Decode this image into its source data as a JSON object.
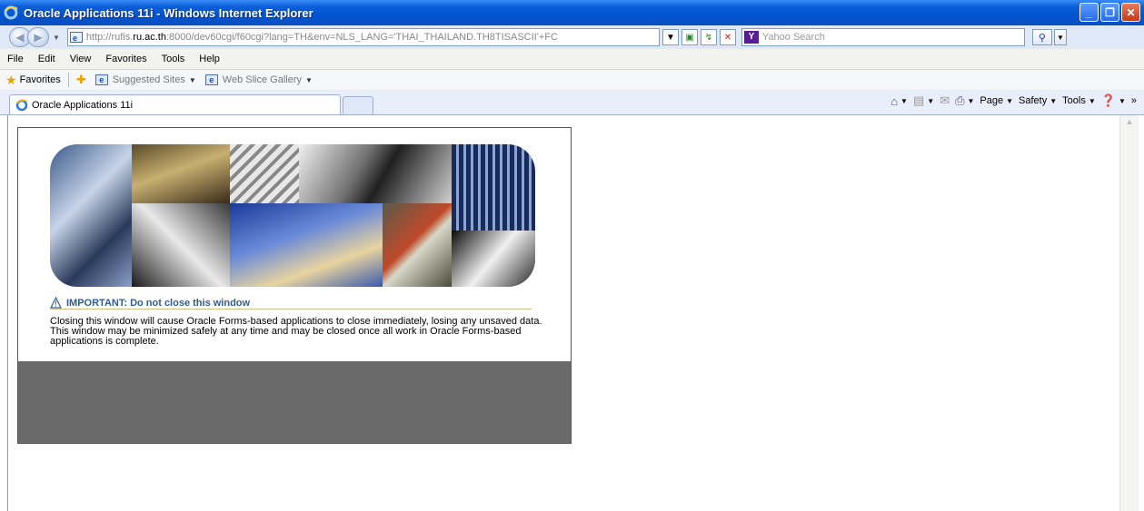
{
  "window": {
    "title": "Oracle Applications 11i - Windows Internet Explorer",
    "controls": [
      "minimize",
      "maximize",
      "close"
    ]
  },
  "address_bar": {
    "url_prefix": "http://rufis.",
    "url_host_bold": "ru.ac.th",
    "url_suffix": ":8000/dev60cgi/f60cgi?lang=TH&env=NLS_LANG='THAI_THAILAND.TH8TISASCII'+FC"
  },
  "search": {
    "placeholder": "Yahoo Search",
    "provider_logo_text": "Y"
  },
  "menu": {
    "items": [
      "File",
      "Edit",
      "View",
      "Favorites",
      "Tools",
      "Help"
    ]
  },
  "favorites_bar": {
    "label": "Favorites",
    "links": [
      "Suggested Sites",
      "Web Slice Gallery"
    ]
  },
  "tabs": {
    "active_label": "Oracle Applications 11i"
  },
  "command_bar": {
    "items": [
      "Page",
      "Safety",
      "Tools"
    ],
    "overflow": "»"
  },
  "page": {
    "important_heading": "IMPORTANT: Do not close this window",
    "closing_text": "Closing this window will cause Oracle Forms-based applications to close immediately, losing any unsaved data. This window may be minimized safely at any time and may be closed once all work in Oracle Forms-based applications is complete."
  },
  "colors": {
    "titlebar": "#0a5fd8",
    "important_heading": "#2f5d91",
    "panel_bottom": "#6a6a6a"
  }
}
